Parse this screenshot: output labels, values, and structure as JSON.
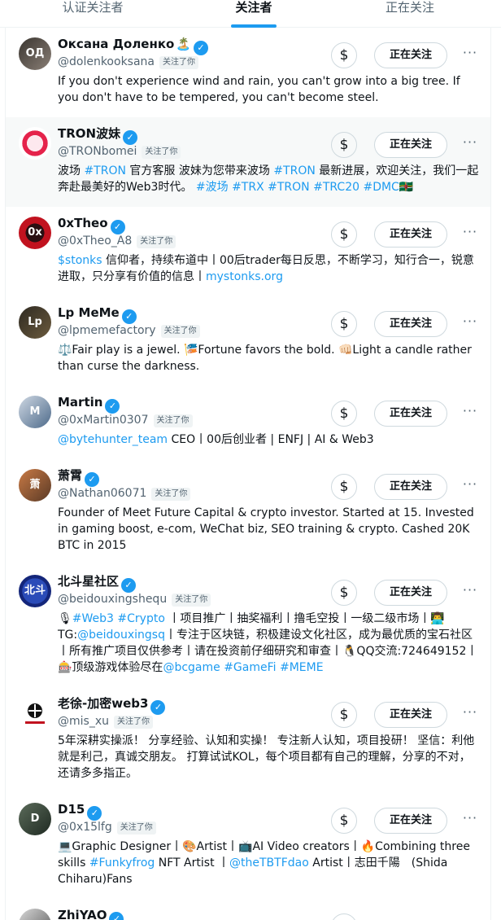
{
  "tabs": {
    "verified": "认证关注者",
    "followers": "关注者",
    "following": "正在关注"
  },
  "labels": {
    "follows_you": "关注了你",
    "following_btn": "正在关注",
    "tip_icon": "$",
    "more_icon": "···",
    "verified_mark": "✓"
  },
  "colors": {
    "accent": "#1d9bf0",
    "text": "#0f1419",
    "secondary": "#536471",
    "highlight_row": "#f7f9f9"
  },
  "users": [
    {
      "name": "Оксана Доленко",
      "emoji": "🏝️",
      "handle": "@dolenkooksana",
      "bio": [
        {
          "t": "If you don't experience wind and rain, you can't grow into a big tree. If you don't have to be tempered, you can't become steel."
        }
      ]
    },
    {
      "name": "TRON波妹",
      "emoji": "",
      "handle": "@TRONbomei",
      "bio": [
        {
          "t": "波场 "
        },
        {
          "t": "#TRON",
          "link": true
        },
        {
          "t": " 官方客服 波妹为您带来波场 "
        },
        {
          "t": "#TRON",
          "link": true
        },
        {
          "t": " 最新进展，欢迎关注，我们一起奔赴最美好的Web3时代。 "
        },
        {
          "t": "#波场",
          "link": true
        },
        {
          "t": " "
        },
        {
          "t": "#TRX",
          "link": true
        },
        {
          "t": " "
        },
        {
          "t": "#TRON",
          "link": true
        },
        {
          "t": " "
        },
        {
          "t": "#TRC20",
          "link": true
        },
        {
          "t": " "
        },
        {
          "t": "#DMC",
          "link": true
        },
        {
          "t": "🇩🇲"
        }
      ]
    },
    {
      "name": "0xTheo",
      "emoji": "",
      "handle": "@0xTheo_A8",
      "bio": [
        {
          "t": "$stonks",
          "link": true
        },
        {
          "t": " 信仰者，持续布道中丨00后trader每日反思，不断学习，知行合一，锐意进取，只分享有价值的信息丨"
        },
        {
          "t": "mystonks.org",
          "link": true
        }
      ]
    },
    {
      "name": "Lp MeMe",
      "emoji": "",
      "handle": "@lpmemefactory",
      "bio": [
        {
          "t": "⚖️Fair play is a jewel. 🎏Fortune favors the bold. 👊🏻Light a candle rather than curse the darkness."
        }
      ]
    },
    {
      "name": "Martin",
      "emoji": "",
      "handle": "@0xMartin0307",
      "bio": [
        {
          "t": "@bytehunter_team",
          "link": true
        },
        {
          "t": " CEO丨00后创业者 | ENFJ | AI & Web3"
        }
      ]
    },
    {
      "name": "萧霄",
      "emoji": "",
      "handle": "@Nathan06071",
      "bio": [
        {
          "t": "Founder of Meet Future Capital & crypto investor. Started at 15. Invested in gaming boost, e-com, WeChat biz, SEO training & crypto. Cashed 20K BTC in 2015"
        }
      ]
    },
    {
      "name": "北斗星社区",
      "emoji": "",
      "handle": "@beidouxingshequ",
      "bio": [
        {
          "t": "🎙"
        },
        {
          "t": "#Web3",
          "link": true
        },
        {
          "t": " "
        },
        {
          "t": "#Crypto",
          "link": true
        },
        {
          "t": " 丨项目推广丨抽奖福利丨撸毛空投丨一级二级市场丨👨‍💻TG:"
        },
        {
          "t": "@beidouxingsq",
          "link": true
        },
        {
          "t": "丨专注于区块链，积极建设文化社区，成为最优质的宝石社区丨所有推广项目仅供参考丨请在投资前仔细研究和审查丨🐧QQ交流:724649152丨🎰顶级游戏体验尽在"
        },
        {
          "t": "@bcgame",
          "link": true
        },
        {
          "t": " "
        },
        {
          "t": "#GameFi",
          "link": true
        },
        {
          "t": " "
        },
        {
          "t": "#MEME",
          "link": true
        }
      ]
    },
    {
      "name": "老徐-加密web3",
      "emoji": "",
      "handle": "@mis_xu",
      "bio": [
        {
          "t": "5年深耕实操派！ 分享经验、认知和实操！ 专注新人认知，项目投研！ 坚信：利他就是利己，真诚交朋友。 打算试试KOL，每个项目都有自己的理解，分享的不对，还请多多指正。"
        }
      ]
    },
    {
      "name": "D15",
      "emoji": "",
      "handle": "@0x15lfg",
      "bio": [
        {
          "t": "💻Graphic Designer丨🎨Artist丨📺AI Video creators丨🔥Combining three skills "
        },
        {
          "t": "#Funkyfrog",
          "link": true
        },
        {
          "t": " NFT Artist 丨"
        },
        {
          "t": "@theTBTFdao",
          "link": true
        },
        {
          "t": " Artist丨志田千陽　(Shida Chiharu)Fans"
        }
      ]
    },
    {
      "name": "ZhiYAO",
      "emoji": "",
      "handle": "",
      "bio": []
    }
  ]
}
